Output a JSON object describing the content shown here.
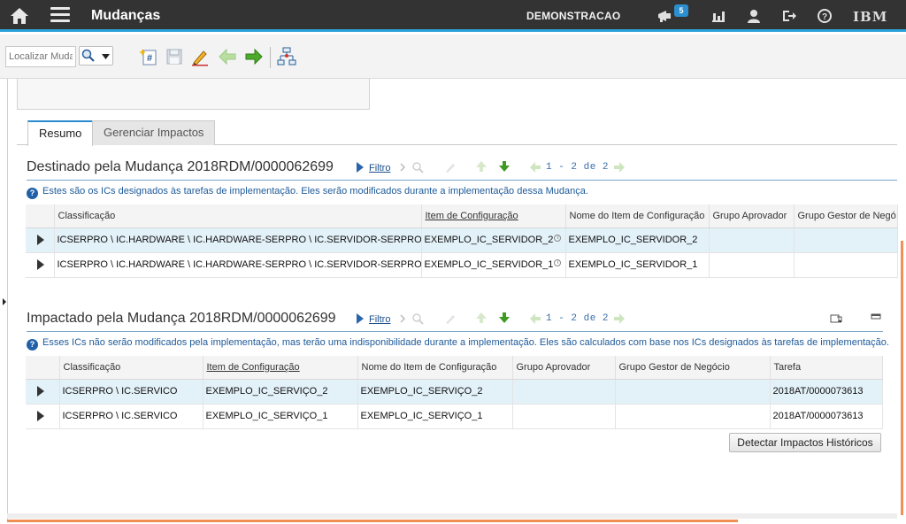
{
  "topbar": {
    "app_title": "Mudanças",
    "tenant": "DEMONSTRACAO",
    "notifications_count": "5",
    "brand": "IBM",
    "icons": [
      "home-icon",
      "menu-icon",
      "bulletin-icon",
      "report-icon",
      "profile-icon",
      "signout-icon",
      "help-icon"
    ]
  },
  "toolbar": {
    "find_placeholder": "Localizar Muda",
    "icons": [
      "search-icon",
      "new-record-icon",
      "save-icon",
      "clear-changes-icon",
      "previous-record-icon",
      "next-record-icon",
      "workflow-icon"
    ]
  },
  "tabs": [
    {
      "label": "Resumo",
      "active": true
    },
    {
      "label": "Gerenciar Impactos",
      "active": false
    }
  ],
  "targets": {
    "title": "Destinado pela Mudança 2018RDM/0000062699",
    "filter_label": "Filtro",
    "pager": "1 - 2 de 2",
    "info": "Estes são os ICs designados às tarefas de implementação. Eles serão modificados durante a implementação dessa Mudança.",
    "columns": [
      "Classificação",
      "Item de Configuração",
      "Nome do Item de Configuração",
      "Grupo Aprovador",
      "Grupo Gestor de Negó"
    ],
    "rows": [
      {
        "classificacao": "ICSERPRO \\ IC.HARDWARE \\ IC.HARDWARE-SERPRO \\ IC.SERVIDOR-SERPRO",
        "item": "EXEMPLO_IC_SERVIDOR_2",
        "nome": "EXEMPLO_IC_SERVIDOR_2",
        "aprovador": "",
        "gestor": ""
      },
      {
        "classificacao": "ICSERPRO \\ IC.HARDWARE \\ IC.HARDWARE-SERPRO \\ IC.SERVIDOR-SERPRO",
        "item": "EXEMPLO_IC_SERVIDOR_1",
        "nome": "EXEMPLO_IC_SERVIDOR_1",
        "aprovador": "",
        "gestor": ""
      }
    ]
  },
  "impacted": {
    "title": "Impactado pela Mudança 2018RDM/0000062699",
    "filter_label": "Filtro",
    "pager": "1 - 2 de 2",
    "info": "Esses ICs não serão modificados pela implementação, mas terão uma indisponibilidade durante a implementação. Eles são calculados com base nos ICs designados às tarefas de implementação.",
    "columns": [
      "Classificação",
      "Item de Configuração",
      "Nome do Item de Configuração",
      "Grupo Aprovador",
      "Grupo Gestor de Negócio",
      "Tarefa"
    ],
    "rows": [
      {
        "classificacao": "ICSERPRO \\ IC.SERVICO",
        "item": "EXEMPLO_IC_SERVIÇO_2",
        "nome": "EXEMPLO_IC_SERVIÇO_2",
        "aprovador": "",
        "gestor": "",
        "tarefa": "2018AT/0000073613"
      },
      {
        "classificacao": "ICSERPRO \\ IC.SERVICO",
        "item": "EXEMPLO_IC_SERVIÇO_1",
        "nome": "EXEMPLO_IC_SERVIÇO_1",
        "aprovador": "",
        "gestor": "",
        "tarefa": "2018AT/0000073613"
      }
    ],
    "detect_button": "Detectar Impactos Históricos"
  },
  "colors": {
    "topbar_bg": "#333333",
    "accent_blue": "#2aa0d8",
    "selected_row": "#e3f1f8",
    "scrollbar": "#f28f54",
    "link": "#1a4f8a"
  }
}
